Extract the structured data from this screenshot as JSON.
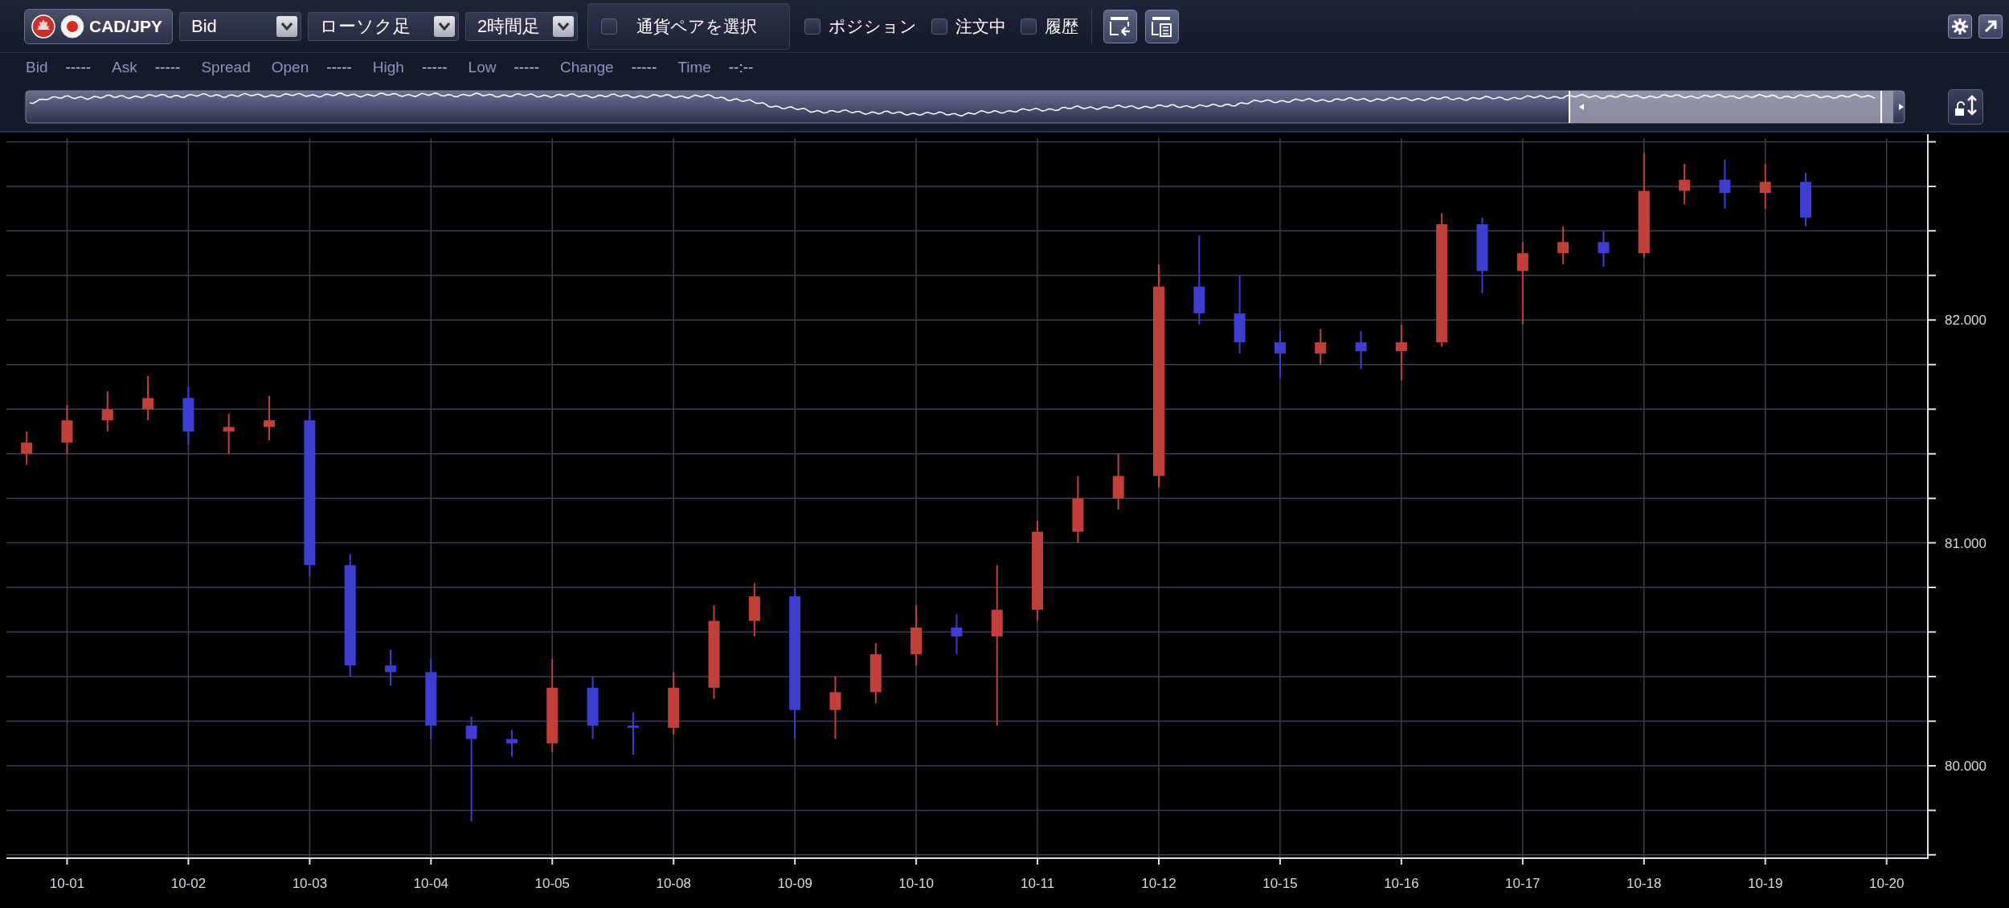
{
  "pair": {
    "label": "CAD/JPY"
  },
  "dropdowns": [
    {
      "value": "Bid"
    },
    {
      "value": "ローソク足"
    },
    {
      "value": "2時間足"
    }
  ],
  "select_pair": {
    "label": "通貨ペアを選択",
    "checked": false
  },
  "toggles": [
    {
      "label": "ポジション",
      "checked": false
    },
    {
      "label": "注文中",
      "checked": false
    },
    {
      "label": "履歴",
      "checked": false
    }
  ],
  "quote": [
    {
      "label": "Bid",
      "value": "-----"
    },
    {
      "label": "Ask",
      "value": "-----"
    },
    {
      "label": "Spread"
    },
    {
      "label": "Open",
      "value": "-----"
    },
    {
      "label": "High",
      "value": "-----"
    },
    {
      "label": "Low",
      "value": "-----"
    },
    {
      "label": "Change",
      "value": "-----"
    },
    {
      "label": "Time",
      "value": "--:--"
    }
  ],
  "chart": {
    "chart_data": {
      "type": "candlestick",
      "categories": [
        null,
        "10-01",
        null,
        null,
        "10-02",
        null,
        null,
        "10-03",
        null,
        null,
        "10-04",
        null,
        null,
        "10-05",
        null,
        null,
        "10-08",
        null,
        null,
        "10-09",
        null,
        null,
        "10-10",
        null,
        null,
        "10-11",
        null,
        null,
        "10-12",
        null,
        null,
        "10-15",
        null,
        null,
        "10-16",
        null,
        null,
        "10-17",
        null,
        null,
        "10-18",
        null,
        null,
        "10-19",
        null,
        null,
        "10-20"
      ],
      "grid": true,
      "ylim": [
        79.585,
        82.816
      ],
      "yticks": [
        {
          "value": 80,
          "label": "80.000"
        },
        {
          "value": 81,
          "label": "81.000"
        },
        {
          "value": 82,
          "label": "82.000"
        }
      ],
      "ohlc": [
        [
          81.4,
          81.5,
          81.35,
          81.45
        ],
        [
          81.45,
          81.62,
          81.4,
          81.55
        ],
        [
          81.55,
          81.68,
          81.5,
          81.6
        ],
        [
          81.6,
          81.75,
          81.55,
          81.65
        ],
        [
          81.65,
          81.7,
          81.44,
          81.5
        ],
        [
          81.5,
          81.58,
          81.4,
          81.52
        ],
        [
          81.52,
          81.66,
          81.46,
          81.55
        ],
        [
          81.55,
          81.6,
          80.85,
          80.9
        ],
        [
          80.9,
          80.95,
          80.4,
          80.45
        ],
        [
          80.45,
          80.52,
          80.36,
          80.42
        ],
        [
          80.42,
          80.48,
          80.12,
          80.18
        ],
        [
          80.18,
          80.22,
          79.75,
          80.12
        ],
        [
          80.12,
          80.16,
          80.04,
          80.1
        ],
        [
          80.1,
          80.48,
          80.06,
          80.35
        ],
        [
          80.35,
          80.4,
          80.12,
          80.18
        ],
        [
          80.18,
          80.24,
          80.05,
          80.17
        ],
        [
          80.17,
          80.42,
          80.14,
          80.35
        ],
        [
          80.35,
          80.72,
          80.3,
          80.65
        ],
        [
          80.65,
          80.82,
          80.58,
          80.76
        ],
        [
          80.76,
          80.8,
          80.12,
          80.25
        ],
        [
          80.25,
          80.4,
          80.12,
          80.33
        ],
        [
          80.33,
          80.55,
          80.28,
          80.5
        ],
        [
          80.5,
          80.72,
          80.45,
          80.62
        ],
        [
          80.62,
          80.68,
          80.5,
          80.58
        ],
        [
          80.58,
          80.9,
          80.18,
          80.7
        ],
        [
          80.7,
          81.1,
          80.65,
          81.05
        ],
        [
          81.05,
          81.3,
          81.0,
          81.2
        ],
        [
          81.2,
          81.4,
          81.15,
          81.3
        ],
        [
          81.3,
          82.25,
          81.25,
          82.15
        ],
        [
          82.15,
          82.38,
          81.98,
          82.03
        ],
        [
          82.03,
          82.2,
          81.85,
          81.9
        ],
        [
          81.9,
          81.95,
          81.74,
          81.85
        ],
        [
          81.85,
          81.96,
          81.8,
          81.9
        ],
        [
          81.9,
          81.95,
          81.78,
          81.86
        ],
        [
          81.86,
          81.98,
          81.73,
          81.9
        ],
        [
          81.9,
          82.48,
          81.88,
          82.43
        ],
        [
          82.43,
          82.46,
          82.12,
          82.22
        ],
        [
          82.22,
          82.35,
          81.98,
          82.3
        ],
        [
          82.3,
          82.42,
          82.25,
          82.35
        ],
        [
          82.35,
          82.4,
          82.24,
          82.3
        ],
        [
          82.3,
          82.75,
          82.28,
          82.58
        ],
        [
          82.58,
          82.7,
          82.52,
          82.63
        ],
        [
          82.63,
          82.72,
          82.5,
          82.57
        ],
        [
          82.57,
          82.7,
          82.5,
          82.62
        ],
        [
          82.62,
          82.66,
          82.42,
          82.46
        ],
        null,
        null
      ]
    }
  }
}
